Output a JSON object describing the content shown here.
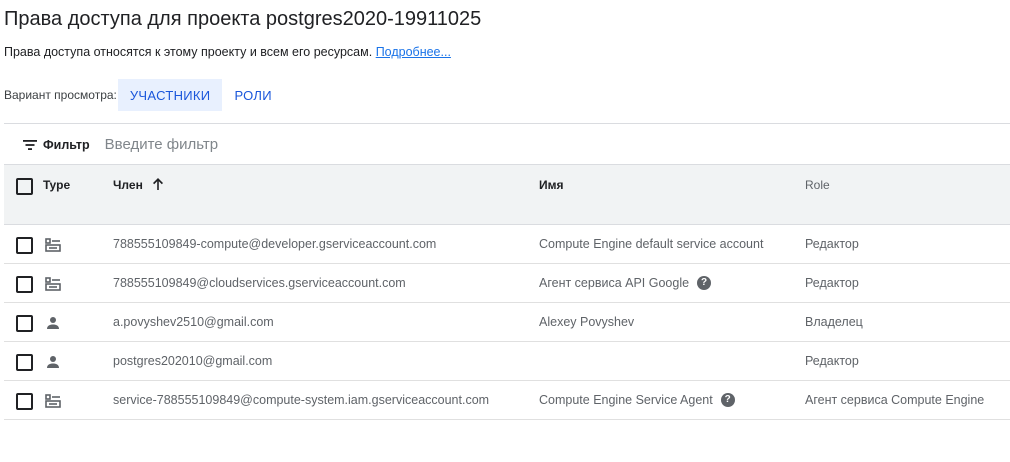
{
  "page": {
    "title": "Права доступа для проекта postgres2020-19911025",
    "subtitle": "Права доступа относятся к этому проекту и всем его ресурсам.",
    "learn_more": "Подробнее..."
  },
  "view": {
    "label": "Вариант просмотра:",
    "tabs": [
      {
        "label": "УЧАСТНИКИ",
        "active": true
      },
      {
        "label": "РОЛИ",
        "active": false
      }
    ]
  },
  "filter": {
    "label": "Фильтр",
    "icon": "filter-icon",
    "placeholder": "Введите фильтр"
  },
  "table": {
    "headers": {
      "type": "Type",
      "member": "Член",
      "name": "Имя",
      "role": "Role"
    },
    "sort": {
      "column": "member",
      "direction": "ascending",
      "icon": "arrow-up-icon"
    },
    "rows": [
      {
        "type_icon": "service-account-icon",
        "member": "788555109849-compute@developer.gserviceaccount.com",
        "name": "Compute Engine default service account",
        "help": false,
        "role": "Редактор"
      },
      {
        "type_icon": "service-account-icon",
        "member": "788555109849@cloudservices.gserviceaccount.com",
        "name": "Агент сервиса API Google",
        "help": true,
        "role": "Редактор"
      },
      {
        "type_icon": "person-icon",
        "member": "a.povyshev2510@gmail.com",
        "name": "Alexey Povyshev",
        "help": false,
        "role": "Владелец"
      },
      {
        "type_icon": "person-icon",
        "member": "postgres202010@gmail.com",
        "name": "",
        "help": false,
        "role": "Редактор"
      },
      {
        "type_icon": "service-account-icon",
        "member": "service-788555109849@compute-system.iam.gserviceaccount.com",
        "name": "Compute Engine Service Agent",
        "help": true,
        "role": "Агент сервиса Compute Engine"
      }
    ]
  }
}
